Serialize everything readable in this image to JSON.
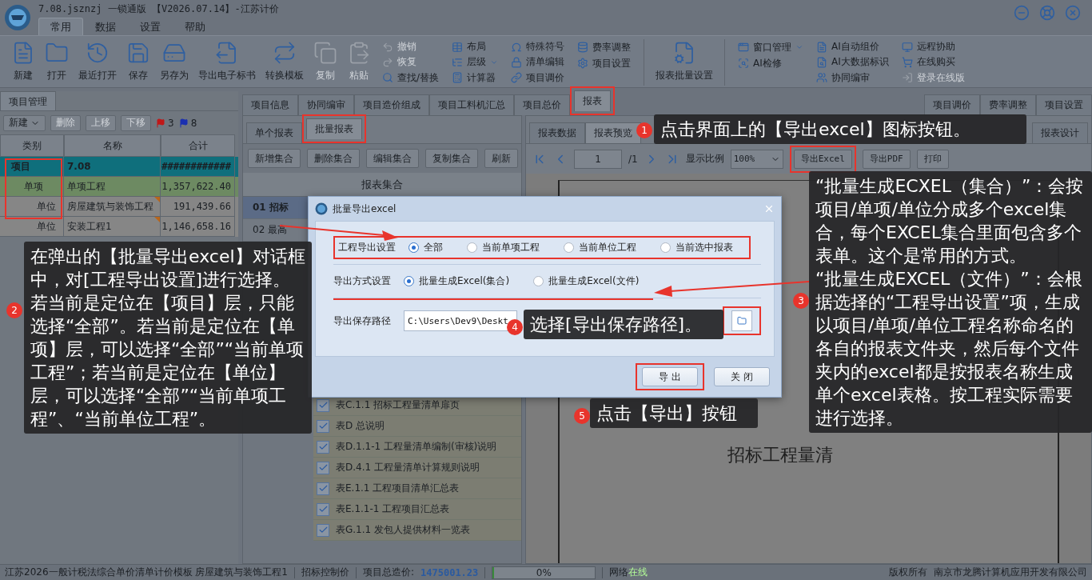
{
  "window": {
    "title": "7.08.jsznzj 一锁通版 【V2026.07.14】-江苏计价"
  },
  "menu_tabs": [
    {
      "label": "常用",
      "selected": true
    },
    {
      "label": "数据",
      "selected": false
    },
    {
      "label": "设置",
      "selected": false
    },
    {
      "label": "帮助",
      "selected": false
    }
  ],
  "ribbon": {
    "large_buttons": [
      {
        "label": "新建",
        "disabled": false
      },
      {
        "label": "打开",
        "disabled": false
      },
      {
        "label": "最近打开",
        "disabled": false
      },
      {
        "label": "保存",
        "disabled": false
      },
      {
        "label": "另存为",
        "disabled": false
      },
      {
        "label": "导出电子标书",
        "disabled": false
      },
      {
        "label": "转换模板",
        "disabled": false
      },
      {
        "label": "复制",
        "disabled": true
      },
      {
        "label": "粘贴",
        "disabled": true
      }
    ],
    "small_columns": [
      [
        {
          "label": "撤销",
          "disabled": true,
          "kind": "button"
        },
        {
          "label": "恢复",
          "disabled": true,
          "kind": "button"
        },
        {
          "label": "查找/替换",
          "disabled": false,
          "kind": "button"
        }
      ],
      [
        {
          "label": "布局",
          "disabled": false,
          "kind": "button"
        },
        {
          "label": "层级",
          "disabled": false,
          "kind": "menu"
        },
        {
          "label": "计算器",
          "disabled": false,
          "kind": "button"
        }
      ],
      [
        {
          "label": "特殊符号",
          "disabled": false,
          "kind": "button"
        },
        {
          "label": "清单编辑",
          "disabled": false,
          "kind": "button"
        },
        {
          "label": "项目调价",
          "disabled": false,
          "kind": "button"
        }
      ],
      [
        {
          "label": "费率调整",
          "disabled": false,
          "kind": "button"
        },
        {
          "label": "项目设置",
          "disabled": false,
          "kind": "button"
        }
      ]
    ],
    "batch_button": {
      "label": "报表批量设置"
    },
    "right_columns": [
      [
        {
          "label": "窗口管理",
          "disabled": false,
          "kind": "menu"
        },
        {
          "label": "AI检修",
          "disabled": false,
          "kind": "button"
        }
      ],
      [
        {
          "label": "AI自动组价",
          "disabled": false,
          "kind": "button"
        },
        {
          "label": "AI大数据标识",
          "disabled": false,
          "kind": "button"
        },
        {
          "label": "协同编审",
          "disabled": false,
          "kind": "button"
        }
      ],
      [
        {
          "label": "远程协助",
          "disabled": false,
          "kind": "button"
        },
        {
          "label": "在线购买",
          "disabled": false,
          "kind": "button"
        },
        {
          "label": "登录在线版",
          "disabled": true,
          "kind": "button"
        }
      ]
    ]
  },
  "project_panel": {
    "tab": "项目管理",
    "toolbar": [
      {
        "label": "新建",
        "disabled": false,
        "kind": "menu"
      },
      {
        "label": "删除",
        "disabled": true,
        "kind": "button"
      },
      {
        "label": "上移",
        "disabled": true,
        "kind": "button"
      },
      {
        "label": "下移",
        "disabled": true,
        "kind": "button"
      }
    ],
    "flags": [
      {
        "count": "3",
        "color": "#c01818"
      },
      {
        "count": "8",
        "color": "#1a2fb0"
      }
    ],
    "columns": [
      "类别",
      "名称",
      "合计"
    ],
    "tree": [
      {
        "kind": "project",
        "type": "项目",
        "name": "7.08",
        "total": "############",
        "selected": true,
        "flagged": false,
        "children": [
          {
            "kind": "item",
            "type": "单项",
            "name": "单项工程",
            "total": "1,357,622.40",
            "selected": false,
            "flagged": false,
            "children": [
              {
                "kind": "unit",
                "type": "单位",
                "name": "房屋建筑与装饰工程",
                "total": "191,439.66",
                "selected": false,
                "flagged": true
              },
              {
                "kind": "unit",
                "type": "单位",
                "name": "安装工程1",
                "total": "1,146,658.16",
                "selected": false,
                "flagged": true
              }
            ]
          }
        ]
      }
    ]
  },
  "main_tabs": [
    {
      "label": "项目信息",
      "selected": false
    },
    {
      "label": "协同编审",
      "selected": false
    },
    {
      "label": "项目造价组成",
      "selected": false
    },
    {
      "label": "项目工料机汇总",
      "selected": false
    },
    {
      "label": "项目总价",
      "selected": false
    },
    {
      "label": "报表",
      "selected": true
    }
  ],
  "side_tabs": [
    "项目调价",
    "费率调整",
    "项目设置"
  ],
  "report_tabs": [
    {
      "label": "单个报表",
      "selected": false
    },
    {
      "label": "批量报表",
      "selected": true
    }
  ],
  "collection_buttons": [
    "新增集合",
    "删除集合",
    "编辑集合",
    "复制集合",
    "刷新"
  ],
  "collection_header": "报表集合",
  "collections": [
    {
      "label": "01 招标",
      "selected": true
    },
    {
      "label": "02 最高",
      "selected": false
    }
  ],
  "report_items": [
    {
      "label": "表C.1.1 招标工程量清单扉页",
      "checked": true
    },
    {
      "label": "表D 总说明",
      "checked": true
    },
    {
      "label": "表D.1.1-1 工程量清单编制(审核)说明",
      "checked": true
    },
    {
      "label": "表D.4.1 工程量清单计算规则说明",
      "checked": true
    },
    {
      "label": "表E.1.1 工程项目清单汇总表",
      "checked": true
    },
    {
      "label": "表E.1.1-1 工程项目汇总表",
      "checked": true
    },
    {
      "label": "表G.1.1 发包人提供材料一览表",
      "checked": true
    }
  ],
  "preview_tabs": [
    {
      "label": "报表数据",
      "selected": false
    },
    {
      "label": "报表预览",
      "selected": true
    }
  ],
  "design_tab": "报表设计",
  "preview_toolbar": {
    "page": "1",
    "pages": "/1",
    "zoom_label": "显示比例",
    "zoom": "100%",
    "buttons": [
      "导出Excel",
      "导出PDF",
      "打印"
    ]
  },
  "preview_page": {
    "heading": "招标工程量清"
  },
  "dialog": {
    "title": "批量导出excel",
    "option_rows": [
      {
        "label": "工程导出设置",
        "options": [
          {
            "label": "全部",
            "selected": true
          },
          {
            "label": "当前单项工程",
            "selected": false
          },
          {
            "label": "当前单位工程",
            "selected": false
          },
          {
            "label": "当前选中报表",
            "selected": false
          }
        ]
      },
      {
        "label": "导出方式设置",
        "options": [
          {
            "label": "批量生成Excel(集合)",
            "selected": true
          },
          {
            "label": "批量生成Excel(文件)",
            "selected": false
          }
        ]
      }
    ],
    "path": {
      "label": "导出保存路径",
      "value": "C:\\Users\\Dev9\\Deskt"
    },
    "buttons": [
      "导 出",
      "关 闭"
    ]
  },
  "callouts": [
    {
      "number": "1",
      "paragraphs": [
        "点击界面上的【导出excel】图标按钮。"
      ]
    },
    {
      "number": "2",
      "paragraphs": [
        "在弹出的【批量导出excel】对话框中，对[工程导出设置]进行选择。若当前是定位在【项目】层，只能选择“全部”。若当前是定位在【单项】层，可以选择“全部”“当前单项工程”；若当前是定位在【单位】层，可以选择“全部”“当前单项工程”、“当前单位工程”。"
      ]
    },
    {
      "number": "3",
      "paragraphs": [
        "“批量生成ECXEL（集合）”：会按项目/单项/单位分成多个excel集合，每个EXCEL集合里面包含多个表单。这个是常用的方式。",
        "“批量生成EXCEL（文件）”：会根据选择的“工程导出设置”项，生成以项目/单项/单位工程名称命名的各自的报表文件夹，然后每个文件夹内的excel都是按报表名称生成单个excel表格。按工程实际需要进行选择。"
      ]
    },
    {
      "number": "4",
      "paragraphs": [
        "选择[导出保存路径]。"
      ]
    },
    {
      "number": "5",
      "paragraphs": [
        "点击【导出】按钮"
      ]
    }
  ],
  "status_bar": {
    "template": "江苏2026一般计税法综合单价清单计价模板 房屋建筑与装饰工程1",
    "mode": "招标控制价",
    "total_label": "项目总造价:",
    "total": "1475001.23",
    "progress": {
      "level": 0,
      "text": "0%"
    },
    "network_label": "网络",
    "network_state": "在线",
    "copyright": "版权所有  南京市龙腾计算机应用开发有限公司"
  }
}
